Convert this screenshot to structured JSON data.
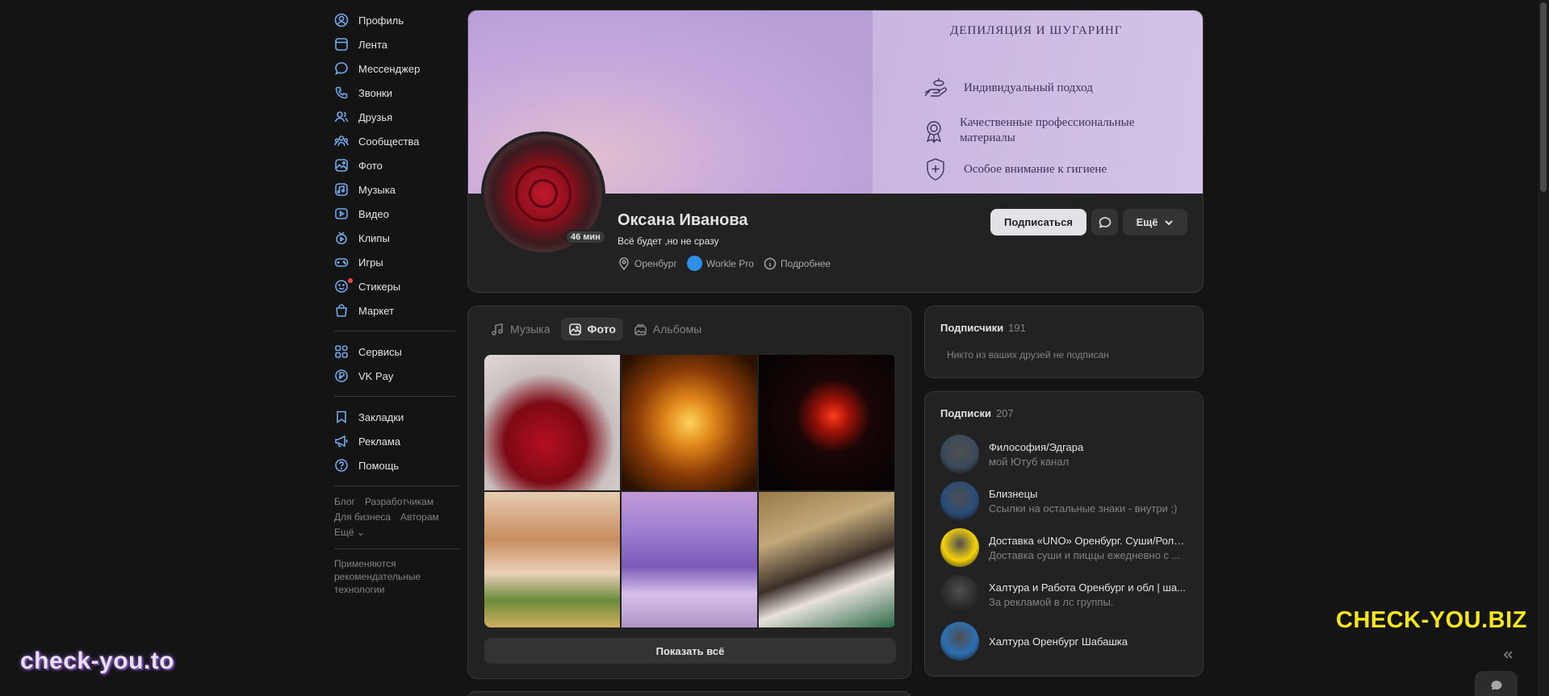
{
  "nav": {
    "items": [
      {
        "label": "Профиль",
        "icon": "profile-icon"
      },
      {
        "label": "Лента",
        "icon": "feed-icon"
      },
      {
        "label": "Мессенджер",
        "icon": "messenger-icon"
      },
      {
        "label": "Звонки",
        "icon": "phone-icon"
      },
      {
        "label": "Друзья",
        "icon": "friends-icon"
      },
      {
        "label": "Сообщества",
        "icon": "communities-icon"
      },
      {
        "label": "Фото",
        "icon": "photo-icon"
      },
      {
        "label": "Музыка",
        "icon": "music-icon"
      },
      {
        "label": "Видео",
        "icon": "video-icon"
      },
      {
        "label": "Клипы",
        "icon": "clips-icon"
      },
      {
        "label": "Игры",
        "icon": "games-icon"
      },
      {
        "label": "Стикеры",
        "icon": "stickers-icon"
      },
      {
        "label": "Маркет",
        "icon": "market-icon"
      }
    ],
    "group2": [
      {
        "label": "Сервисы",
        "icon": "services-icon"
      },
      {
        "label": "VK Pay",
        "icon": "vkpay-icon"
      }
    ],
    "group3": [
      {
        "label": "Закладки",
        "icon": "bookmark-icon"
      },
      {
        "label": "Реклама",
        "icon": "ads-icon"
      },
      {
        "label": "Помощь",
        "icon": "help-icon"
      }
    ],
    "footer_links": [
      "Блог",
      "Разработчикам",
      "Для бизнеса",
      "Авторам",
      "Ещё ⌄"
    ],
    "footer_note": "Применяются рекомендательные технологии"
  },
  "cover": {
    "title": "ДЕПИЛЯЦИЯ И ШУГАРИНГ",
    "lines": [
      "Индивидуальный подход",
      "Качественные профессиональные материалы",
      "Особое внимание к гигиене"
    ]
  },
  "profile": {
    "name": "Оксана Иванова",
    "status": "Всё будет ,но не сразу",
    "online_badge": "46 мин",
    "city": "Оренбург",
    "work": "Workle Pro",
    "details": "Подробнее",
    "subscribe_label": "Подписаться",
    "more_label": "Ещё"
  },
  "photos": {
    "tabs": [
      {
        "label": "Музыка",
        "icon": "music-icon",
        "active": false
      },
      {
        "label": "Фото",
        "icon": "photo-icon",
        "active": true
      },
      {
        "label": "Альбомы",
        "icon": "albums-icon",
        "active": false
      }
    ],
    "count": 6,
    "show_all_label": "Показать всё"
  },
  "followers": {
    "title": "Подписчики",
    "count": "191",
    "empty_text": "Никто из ваших друзей не подписан"
  },
  "subscriptions": {
    "title": "Подписки",
    "count": "207",
    "items": [
      {
        "name": "Философия/Эдгара",
        "desc": "мой Ютуб канал",
        "color": "#3b4a5a"
      },
      {
        "name": "Близнецы",
        "desc": "Ссылки на остальные знаки - внутри ;)",
        "color": "#2a4c78"
      },
      {
        "name": "Доставка «UNO» Оренбург. Суши/Ролл...",
        "desc": "Доставка суши и пиццы ежедневно с ...",
        "color": "#f4d20c"
      },
      {
        "name": "Халтура и Работа Оренбург и обл | ша...",
        "desc": "За рекламой в лс группы.",
        "color": "#2b2b2b"
      },
      {
        "name": "Халтура Оренбург Шабашка",
        "desc": "",
        "color": "#2c6fb3"
      }
    ]
  },
  "watermarks": {
    "left": "check-you.to",
    "right": "CHECK-YOU.BIZ"
  }
}
